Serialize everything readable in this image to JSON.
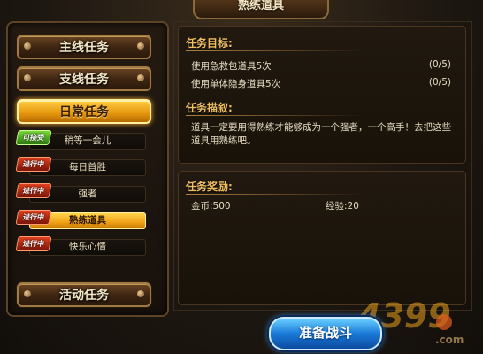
{
  "window": {
    "title": "熟练道具"
  },
  "categories": {
    "main": "主线任务",
    "side": "支线任务",
    "daily": "日常任务",
    "event": "活动任务"
  },
  "quests": [
    {
      "tag": "可接受",
      "tag_color": "green",
      "name": "稍等一会儿"
    },
    {
      "tag": "进行中",
      "tag_color": "red",
      "name": "每日首胜"
    },
    {
      "tag": "进行中",
      "tag_color": "red",
      "name": "强者"
    },
    {
      "tag": "进行中",
      "tag_color": "red",
      "name": "熟练道具"
    },
    {
      "tag": "进行中",
      "tag_color": "red",
      "name": "快乐心情"
    }
  ],
  "goal": {
    "heading": "任务目标:",
    "items": [
      {
        "text": "使用急救包道具5次",
        "progress": "(0/5)"
      },
      {
        "text": "使用单体隐身道具5次",
        "progress": "(0/5)"
      }
    ]
  },
  "description": {
    "heading": "任务描叙:",
    "text": "道具一定要用得熟练才能够成为一个强者，一个高手！去把这些道具用熟练吧。"
  },
  "reward": {
    "heading": "任务奖励:",
    "gold": "金币:500",
    "exp": "经验:20"
  },
  "battle_button": "准备战斗",
  "watermark": {
    "number": "4399",
    "suffix": ".com"
  },
  "colors": {
    "accent_gold": "#f0c060",
    "active_orange": "#f0a218",
    "button_blue": "#1a7ad8"
  }
}
